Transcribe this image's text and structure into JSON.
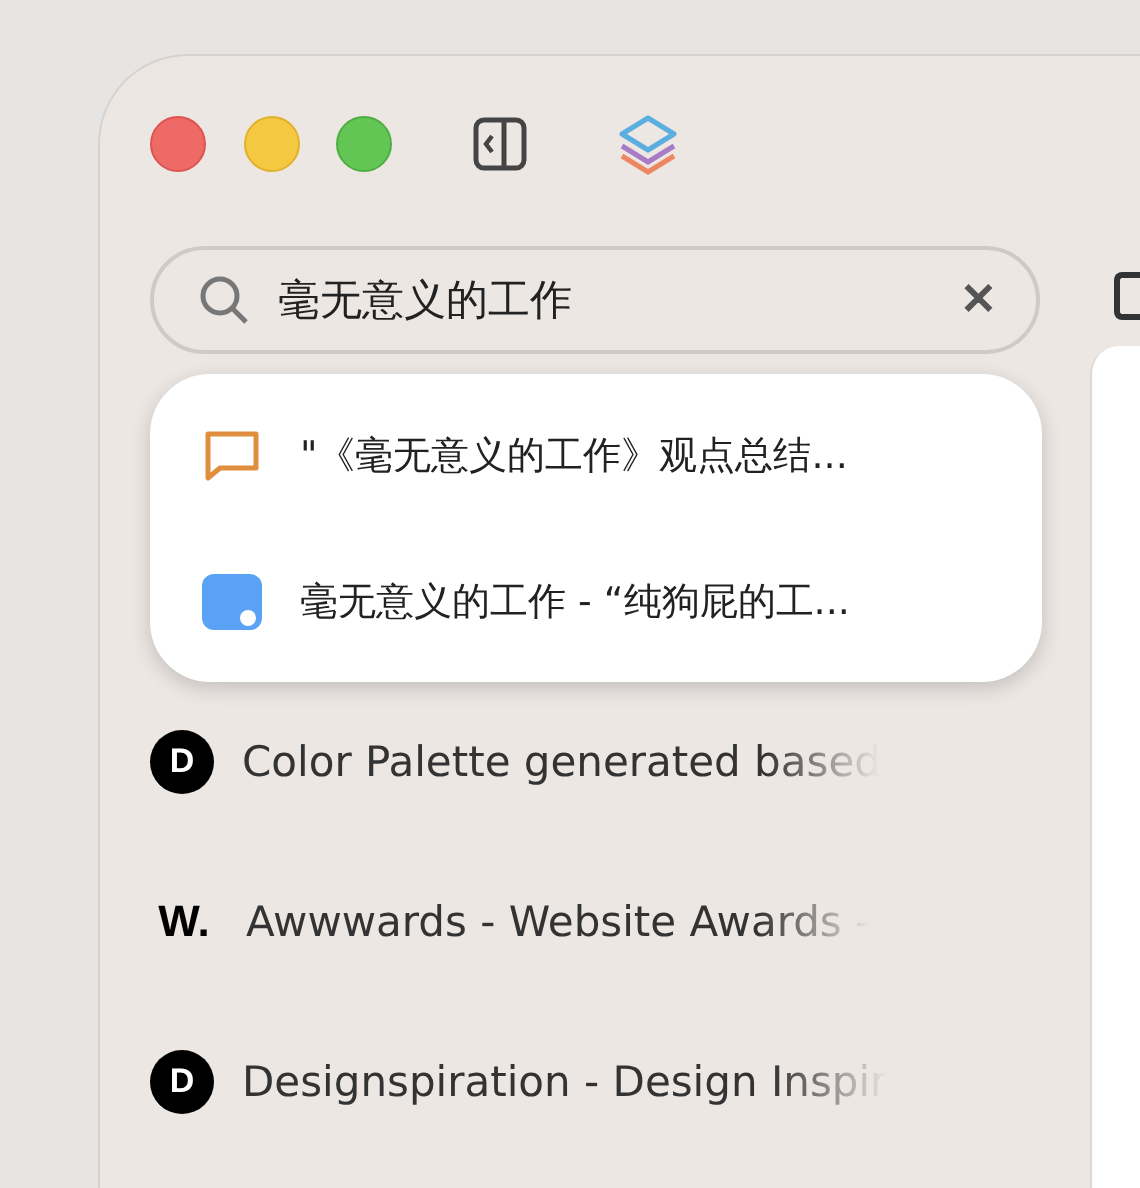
{
  "search": {
    "value": "毫无意义的工作",
    "clear": "✕"
  },
  "suggestions": [
    {
      "kind": "note",
      "text": "\"《毫无意义的工作》观点总结..."
    },
    {
      "kind": "chat",
      "text": "毫无意义的工作 - “纯狗屁的工..."
    }
  ],
  "bookmarks": [
    {
      "kind": "circle",
      "badge": "D",
      "title": "Color Palette generated based"
    },
    {
      "kind": "plain",
      "badge": "W.",
      "title": "Awwwards - Website Awards -"
    },
    {
      "kind": "circle",
      "badge": "D",
      "title": "Designspiration - Design Inspir"
    }
  ]
}
